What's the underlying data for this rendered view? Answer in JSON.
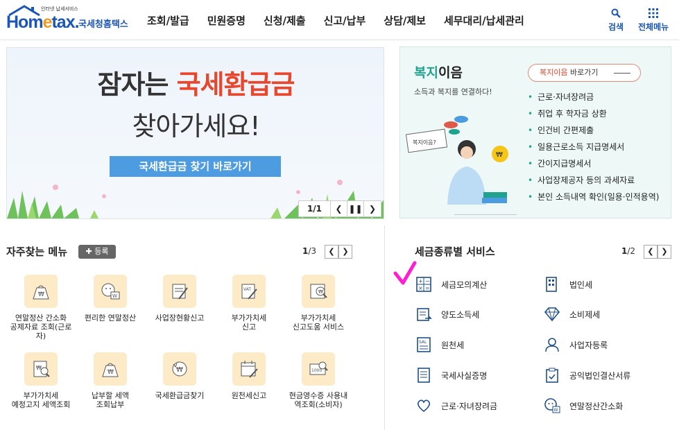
{
  "header": {
    "logo_main": "Hom",
    "logo_e": "e",
    "logo_tax": "tax.",
    "logo_small": "인터넷 납세서비스",
    "logo_kor": "국세청홈택스",
    "nav": [
      "조회/발급",
      "민원증명",
      "신청/제출",
      "신고/납부",
      "상담/제보",
      "세무대리/납세관리"
    ],
    "search_label": "검색",
    "menu_label": "전체메뉴"
  },
  "banner": {
    "line1_prefix": "잠자는 ",
    "line1_highlight": "국세환급금",
    "line2": "찾아가세요!",
    "cta": "국세환급금 찾기 바로가기",
    "page": "1/1"
  },
  "welfare": {
    "title_g": "복지",
    "title_rest": "이음",
    "sub": "소득과 복지를 연결하다!",
    "go_r": "복지이음",
    "go_rest": " 바로가기",
    "items": [
      "근로·자녀장려금",
      "취업 후 학자금 상환",
      "인건비 간편제출",
      "일용근로소득 지급명세서",
      "간이지급명세서",
      "사업장제공자 등의 과세자료",
      "본인 소득내역 확인(일용·인적용역)"
    ],
    "sign_text": "복지이음?"
  },
  "favorites": {
    "title": "자주찾는 메뉴",
    "register": "등록",
    "page_cur": "1",
    "page_total": "/3",
    "items": [
      {
        "label": "연말정산 간소화\n공제자료 조회(근로\n자)",
        "icon": "bag-icon"
      },
      {
        "label": "편리한 연말정산",
        "icon": "face-w-icon"
      },
      {
        "label": "사업장현황신고",
        "icon": "document-pen-icon"
      },
      {
        "label": "부가가치세\n신고",
        "icon": "vat-icon"
      },
      {
        "label": "부가가치세\n신고도움 서비스",
        "icon": "won-search-icon"
      },
      {
        "label": "부가가치세\n예정고지 세액조회",
        "icon": "won-doc-search-icon"
      },
      {
        "label": "납부할 세액\n조회납부",
        "icon": "bag-icon"
      },
      {
        "label": "국세환급금찾기",
        "icon": "won-refresh-icon"
      },
      {
        "label": "원천세신고",
        "icon": "calendar-pen-icon"
      },
      {
        "label": "현금영수증 사용내\n역조회(소비자)",
        "icon": "receipt-search-icon"
      }
    ]
  },
  "tax_services": {
    "title": "세금종류별 서비스",
    "page_cur": "1",
    "page_total": "/2",
    "left": [
      "세금모의계산",
      "양도소득세",
      "원천세",
      "국세사실증명",
      "근로·자녀장려금"
    ],
    "right": [
      "법인세",
      "소비제세",
      "사업자등록",
      "공익법인결산서류",
      "연말정산간소화"
    ]
  },
  "colors": {
    "brand": "#1a56b5",
    "highlight": "#e8462d",
    "welfare_green": "#1fa38f",
    "cta": "#4d9be0",
    "checkmark": "#ff1fd0"
  }
}
